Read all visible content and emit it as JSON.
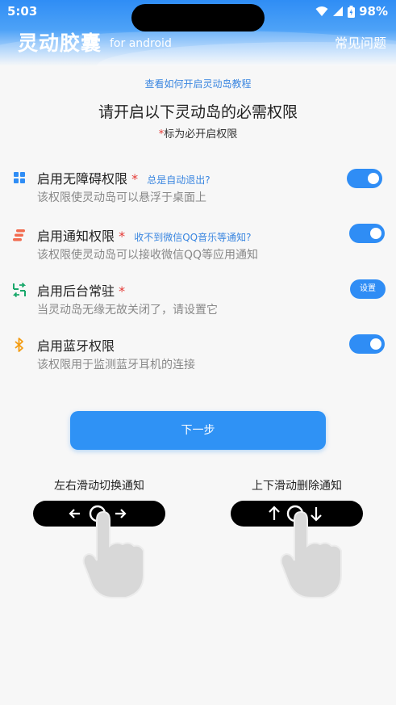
{
  "status_bar": {
    "time": "5:03",
    "battery": "98%"
  },
  "header": {
    "title": "灵动胶囊",
    "subtitle": "for android",
    "faq": "常见问题"
  },
  "intro": {
    "tutorial_link": "查看如何开启灵动岛教程",
    "title": "请开启以下灵动岛的必需权限",
    "required_star": "*",
    "required_note": "标为必开启权限"
  },
  "permissions": [
    {
      "title": "启用无障碍权限",
      "star": "*",
      "hint": "总是自动退出?",
      "desc": "该权限使灵动岛可以悬浮于桌面上",
      "control": "toggle",
      "enabled": true
    },
    {
      "title": "启用通知权限",
      "star": "*",
      "hint": "收不到微信QQ音乐等通知?",
      "desc": "该权限使灵动岛可以接收微信QQ等应用通知",
      "control": "toggle",
      "enabled": true
    },
    {
      "title": "启用后台常驻",
      "star": "*",
      "hint": "",
      "desc": "当灵动岛无缘无故关闭了，请设置它",
      "control": "button",
      "button_label": "设置"
    },
    {
      "title": "启用蓝牙权限",
      "star": "",
      "hint": "",
      "desc": "该权限用于监测蓝牙耳机的连接",
      "control": "toggle",
      "enabled": true
    }
  ],
  "next_button": "下一步",
  "gestures": [
    {
      "label": "左右滑动切换通知"
    },
    {
      "label": "上下滑动删除通知"
    }
  ],
  "colors": {
    "accent": "#2f8df5",
    "hint": "#3a86e0",
    "required": "#e53935"
  }
}
